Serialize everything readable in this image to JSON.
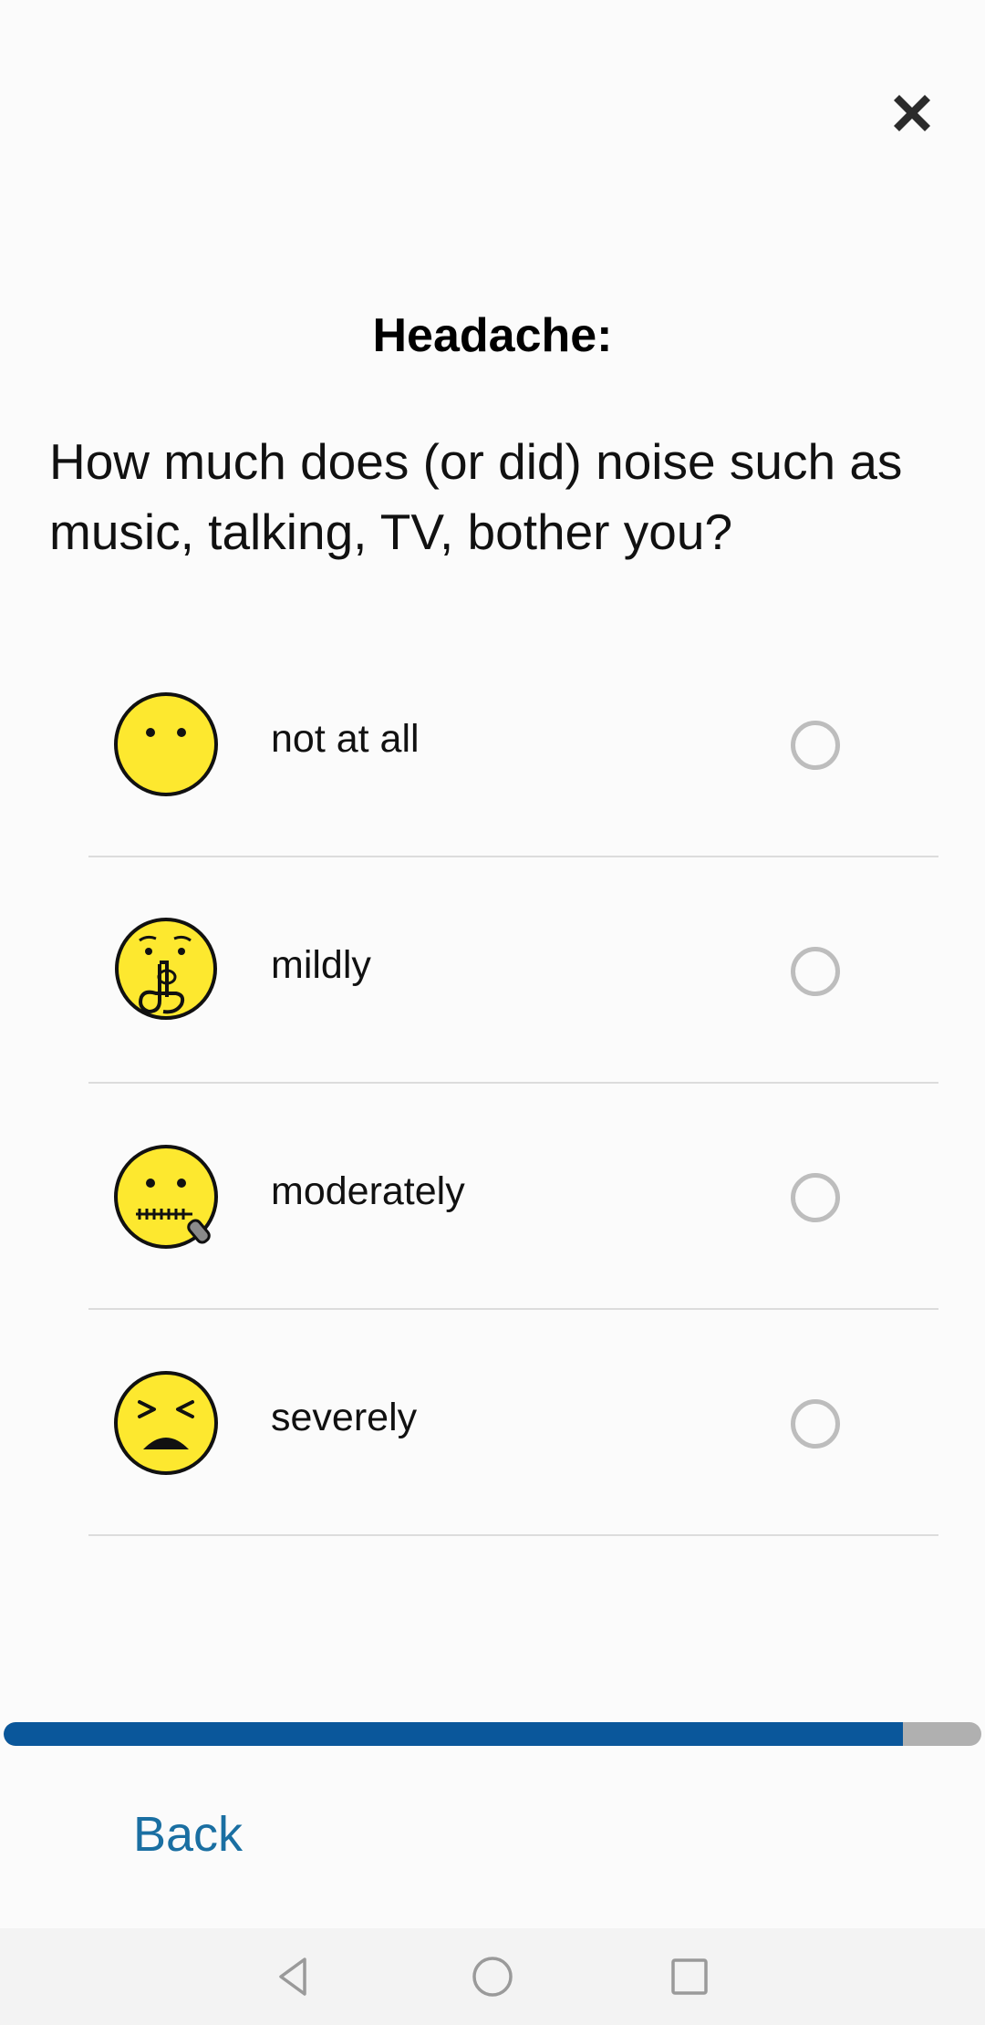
{
  "header": {
    "close_icon": "close-icon"
  },
  "title": "Headache:",
  "question": "How much does (or did) noise such as music, talking, TV, bother you?",
  "options": [
    {
      "label": "not at all",
      "icon": "neutral-face-icon",
      "selected": false
    },
    {
      "label": "mildly",
      "icon": "shushing-face-icon",
      "selected": false
    },
    {
      "label": "moderately",
      "icon": "zipper-mouth-face-icon",
      "selected": false
    },
    {
      "label": "severely",
      "icon": "persevering-face-icon",
      "selected": false
    }
  ],
  "progress": {
    "fraction": 0.92
  },
  "footer": {
    "back_label": "Back"
  },
  "colors": {
    "accent": "#0a579b",
    "link": "#1a6fa2",
    "radio": "#bdbdbd",
    "emoji_yellow": "#fde82f"
  },
  "navbar": {
    "back_icon": "nav-back-icon",
    "home_icon": "nav-home-icon",
    "recents_icon": "nav-recents-icon"
  }
}
